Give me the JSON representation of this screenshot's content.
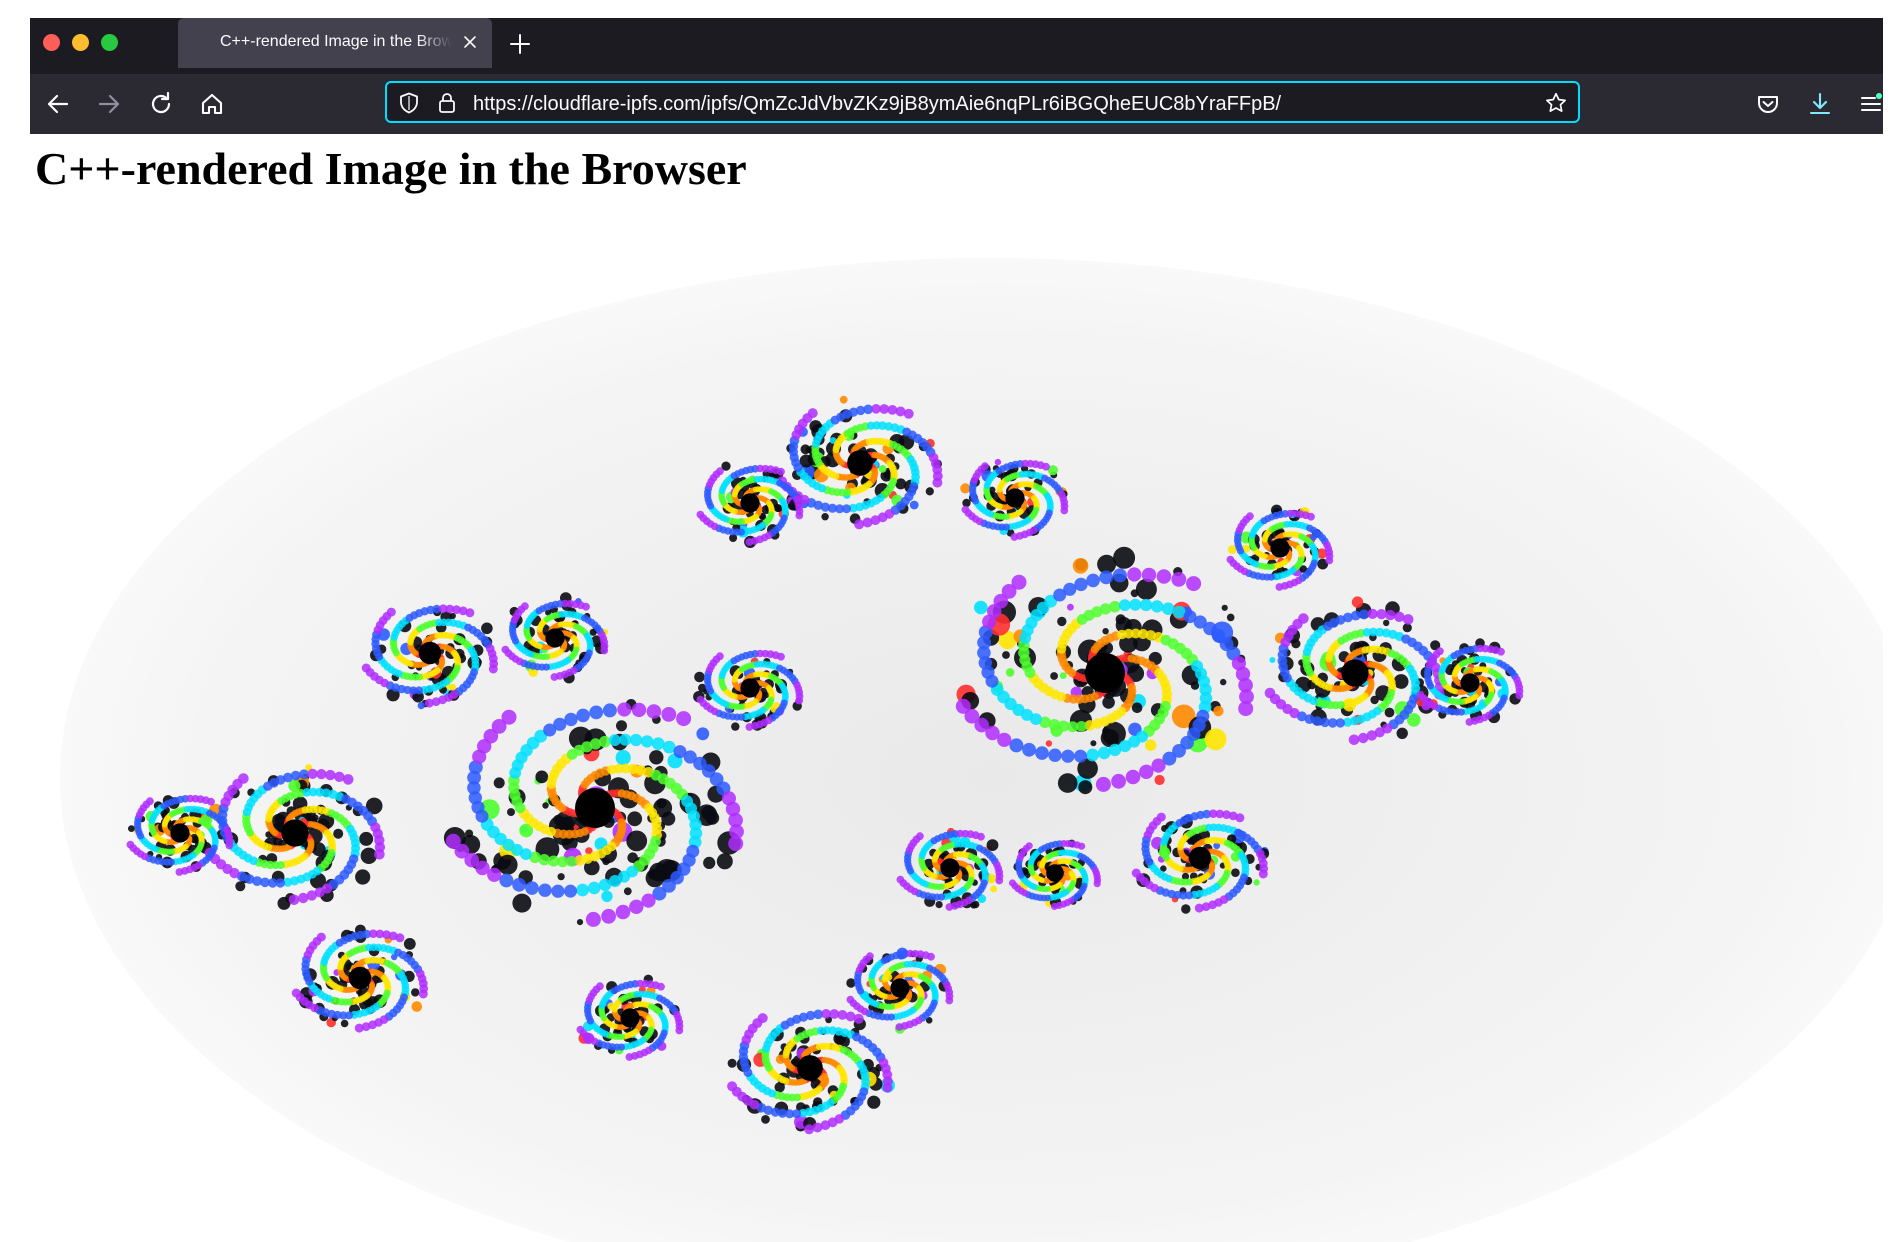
{
  "tab": {
    "title": "C++-rendered Image in the Browser"
  },
  "toolbar": {
    "url": "https://cloudflare-ipfs.com/ipfs/QmZcJdVbvZKz9jB8ymAie6nqPLr6iBGQheEUC8bYraFFpB/"
  },
  "page": {
    "heading": "C++-rendered Image in the Browser"
  },
  "icons": {
    "back": "back-arrow-icon",
    "forward": "forward-arrow-icon",
    "reload": "reload-icon",
    "home": "home-icon",
    "tracking": "shield-icon",
    "lock": "lock-icon",
    "bookmark": "star-icon",
    "pocket": "pocket-icon",
    "downloads": "download-icon",
    "menu": "hamburger-menu-icon",
    "new_tab": "plus-icon",
    "close_tab": "close-icon"
  },
  "colors": {
    "tabstrip_bg": "#1c1b22",
    "toolbar_bg": "#2b2a33",
    "urlbar_focus": "#00ddff",
    "downloads_accent": "#54ffbd"
  }
}
